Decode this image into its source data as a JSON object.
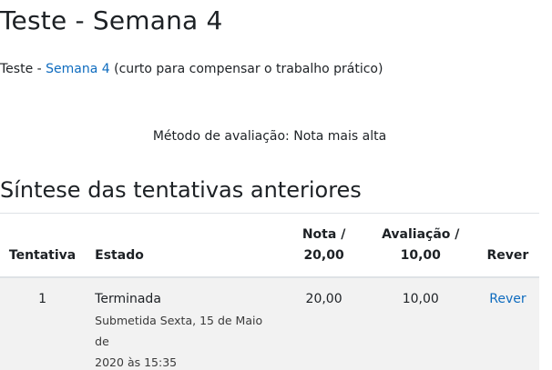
{
  "page": {
    "title": "Teste - Semana 4"
  },
  "intro": {
    "prefix": "Teste - ",
    "link_text": "Semana 4",
    "suffix": " (curto para compensar o trabalho prático)"
  },
  "grading_method": "Método de avaliação: Nota mais alta",
  "summary": {
    "title": "Síntese das tentativas anteriores",
    "columns": {
      "attempt": "Tentativa",
      "state": "Estado",
      "grade_line1": "Nota /",
      "grade_line2": "20,00",
      "mark_line1": "Avaliação /",
      "mark_line2": "10,00",
      "review": "Rever"
    },
    "rows": [
      {
        "attempt": "1",
        "state": "Terminada",
        "state_detail_line1": "Submetida Sexta, 15 de Maio de",
        "state_detail_line2": "2020 às 15:35",
        "grade": "20,00",
        "mark": "10,00",
        "review_link": "Rever"
      }
    ]
  },
  "colors": {
    "link": "#0f6cbf",
    "row_background": "#f2f2f2",
    "border": "#dee2e6"
  }
}
